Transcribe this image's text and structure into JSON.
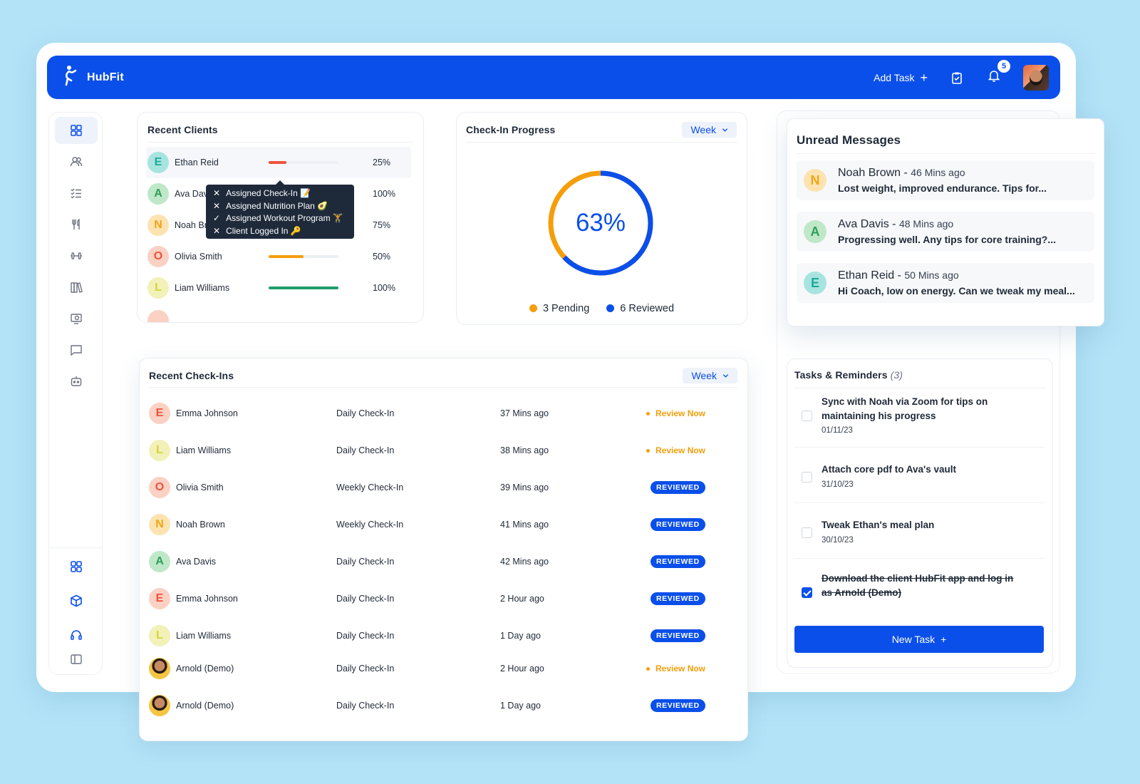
{
  "colors": {
    "primary": "#0a4fea",
    "pending": "#f59e0b",
    "track": "#eceff3",
    "initial_teal_bg": "#a8e4df",
    "initial_teal_fg": "#1eaa9b",
    "initial_green_bg": "#bfe8c8",
    "initial_green_fg": "#2f9e58",
    "initial_orange_bg": "#fde3b0",
    "initial_orange_fg": "#f2a516",
    "initial_red_bg": "#fbd1c4",
    "initial_red_fg": "#f0533a",
    "initial_yellow_bg": "#f1f1b8",
    "initial_yellow_fg": "#d6d23a"
  },
  "header": {
    "app_name": "HubFit",
    "logo_icon": "hubfit-figure-icon",
    "add_task_label": "Add Task",
    "add_task_icon": "plus-icon",
    "clipboard_icon": "clipboard-check-icon",
    "bell_icon": "bell-icon",
    "notification_count": "5"
  },
  "sidebar": {
    "items": [
      {
        "icon": "dashboard-grid-icon",
        "active": true
      },
      {
        "icon": "users-icon"
      },
      {
        "icon": "checklist-icon"
      },
      {
        "icon": "fork-knife-icon"
      },
      {
        "icon": "dumbbell-icon"
      },
      {
        "icon": "library-icon"
      },
      {
        "icon": "video-icon"
      },
      {
        "icon": "chat-icon"
      },
      {
        "icon": "robot-icon"
      }
    ],
    "bottom_items": [
      {
        "icon": "apps-icon"
      },
      {
        "icon": "cube-icon"
      },
      {
        "icon": "support-icon"
      },
      {
        "icon": "panel-toggle-icon"
      }
    ]
  },
  "recent_clients": {
    "title": "Recent Clients",
    "rows": [
      {
        "initial": "E",
        "name": "Ethan Reid",
        "percent": "25%",
        "progress": 0.25,
        "color": "teal",
        "bar_color": "#f0533a"
      },
      {
        "initial": "A",
        "name": "Ava Dav",
        "percent": "100%",
        "progress": 1.0,
        "color": "green",
        "bar_color": "#1e9e6a"
      },
      {
        "initial": "N",
        "name": "Noah Br",
        "percent": "75%",
        "progress": 0.75,
        "color": "orange",
        "bar_color": "#f59e0b"
      },
      {
        "initial": "O",
        "name": "Olivia Smith",
        "percent": "50%",
        "progress": 0.5,
        "color": "red",
        "bar_color": "#f59e0b"
      },
      {
        "initial": "L",
        "name": "Liam Williams",
        "percent": "100%",
        "progress": 1.0,
        "color": "yellow",
        "bar_color": "#1e9e6a"
      }
    ],
    "tooltip": [
      {
        "mark": "✕",
        "text": "Assigned Check-In 📝"
      },
      {
        "mark": "✕",
        "text": "Assigned Nutrition Plan 🥑"
      },
      {
        "mark": "✓",
        "text": "Assigned Workout Program 🏋"
      },
      {
        "mark": "✕",
        "text": "Client Logged In 🔑"
      }
    ]
  },
  "checkin_progress": {
    "title": "Check-In Progress",
    "period": "Week",
    "percent_label": "63%",
    "completed_fraction": 0.63,
    "pending_label": "3 Pending",
    "reviewed_label": "6 Reviewed"
  },
  "unread_messages": {
    "title": "Unread Messages",
    "items": [
      {
        "initial": "N",
        "name": "Noah Brown - ",
        "ago": "46 Mins ago",
        "preview": "Lost weight, improved endurance. Tips for...",
        "color": "orange"
      },
      {
        "initial": "A",
        "name": "Ava Davis - ",
        "ago": "48 Mins ago",
        "preview": "Progressing well. Any tips for core training?...",
        "color": "green"
      },
      {
        "initial": "E",
        "name": "Ethan Reid - ",
        "ago": "50 Mins ago",
        "preview": "Hi Coach, low on energy. Can we tweak my meal...",
        "color": "teal"
      }
    ]
  },
  "recent_checkins": {
    "title": "Recent Check-Ins",
    "period": "Week",
    "rows": [
      {
        "initial": "E",
        "name": "Emma Johnson",
        "type": "Daily Check-In",
        "time": "37 Mins ago",
        "status": "Review Now",
        "color": "red"
      },
      {
        "initial": "L",
        "name": "Liam Williams",
        "type": "Daily Check-In",
        "time": "38 Mins ago",
        "status": "Review Now",
        "color": "yellow"
      },
      {
        "initial": "O",
        "name": "Olivia Smith",
        "type": "Weekly Check-In",
        "time": "39 Mins ago",
        "status": "REVIEWED",
        "color": "red"
      },
      {
        "initial": "N",
        "name": "Noah Brown",
        "type": "Weekly Check-In",
        "time": "41 Mins ago",
        "status": "REVIEWED",
        "color": "orange"
      },
      {
        "initial": "A",
        "name": "Ava Davis",
        "type": "Daily Check-In",
        "time": "42 Mins ago",
        "status": "REVIEWED",
        "color": "green"
      },
      {
        "initial": "E",
        "name": "Emma Johnson",
        "type": "Daily Check-In",
        "time": "2 Hour ago",
        "status": "REVIEWED",
        "color": "red"
      },
      {
        "initial": "L",
        "name": "Liam Williams",
        "type": "Daily Check-In",
        "time": "1 Day ago",
        "status": "REVIEWED",
        "color": "yellow"
      },
      {
        "initial": "",
        "name": "Arnold (Demo)",
        "type": "Daily Check-In",
        "time": "2 Hour ago",
        "status": "Review Now",
        "color": "photo"
      },
      {
        "initial": "",
        "name": "Arnold (Demo)",
        "type": "Daily Check-In",
        "time": "1 Day ago",
        "status": "REVIEWED",
        "color": "photo"
      }
    ]
  },
  "tasks": {
    "title": "Tasks & Reminders",
    "count": "(3)",
    "items": [
      {
        "text": "Sync with Noah via Zoom for tips on maintaining his progress",
        "date": "01/11/23",
        "done": false
      },
      {
        "text": "Attach core pdf to Ava's vault",
        "date": "31/10/23",
        "done": false
      },
      {
        "text": "Tweak Ethan's meal plan",
        "date": "30/10/23",
        "done": false
      },
      {
        "text": "Download the client HubFit app and log in as Arnold (Demo)",
        "date": "",
        "done": true
      }
    ],
    "new_task_label": "New Task"
  }
}
